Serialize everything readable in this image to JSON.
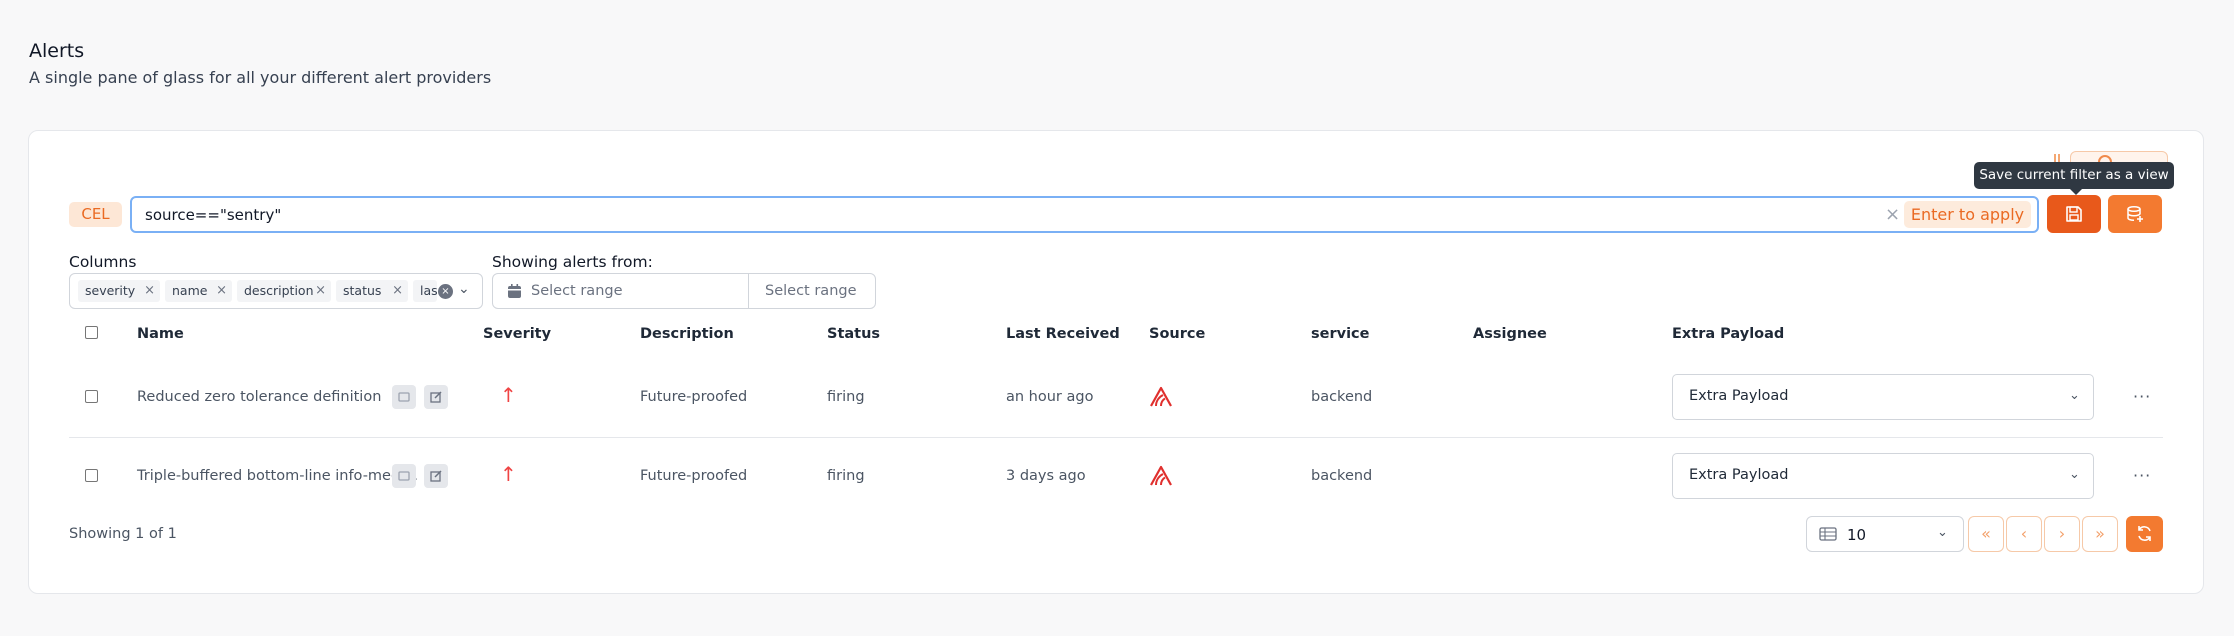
{
  "header": {
    "title": "Alerts",
    "subtitle": "A single pane of glass for all your different alert providers"
  },
  "toolbar": {
    "tooltip": "Save current filter as a view",
    "cel_label": "CEL",
    "search_value": "source==\"sentry\"",
    "clear_symbol": "×",
    "enter_label": "Enter to apply",
    "save_view_icon": "floppy-disk-icon",
    "save_filter_icon": "database-plus-icon",
    "accent_color": "#e8591b"
  },
  "columns": {
    "label": "Columns",
    "chips": [
      {
        "label": "severity",
        "x": "×"
      },
      {
        "label": "name",
        "x": "×"
      },
      {
        "label": "description",
        "x": "×"
      },
      {
        "label": "status",
        "x": "×"
      },
      {
        "label": "las"
      }
    ],
    "clear_symbol": "×",
    "caret": "⌄"
  },
  "timeframe": {
    "label": "Showing alerts from:",
    "start_placeholder": "Select range",
    "end_placeholder": "Select range"
  },
  "table": {
    "headers": [
      "Name",
      "Severity",
      "Description",
      "Status",
      "Last Received",
      "Source",
      "service",
      "Assignee",
      "Extra Payload"
    ],
    "rows": [
      {
        "name": "Reduced zero tolerance definition",
        "severity": "↑",
        "description": "Future-proofed",
        "status": "firing",
        "last_received": "an hour ago",
        "source_icon": "sentry-icon",
        "service": "backend",
        "assignee": "",
        "extra_payload": "Extra Payload",
        "more": "···"
      },
      {
        "name": "Triple-buffered bottom-line info-medi...",
        "severity": "↑",
        "description": "Future-proofed",
        "status": "firing",
        "last_received": "3 days ago",
        "source_icon": "sentry-icon",
        "service": "backend",
        "assignee": "",
        "extra_payload": "Extra Payload",
        "more": "···"
      }
    ]
  },
  "footer": {
    "showing": "Showing 1 of 1",
    "page_size": "10",
    "nav": [
      "«",
      "‹",
      "›",
      "»"
    ]
  }
}
